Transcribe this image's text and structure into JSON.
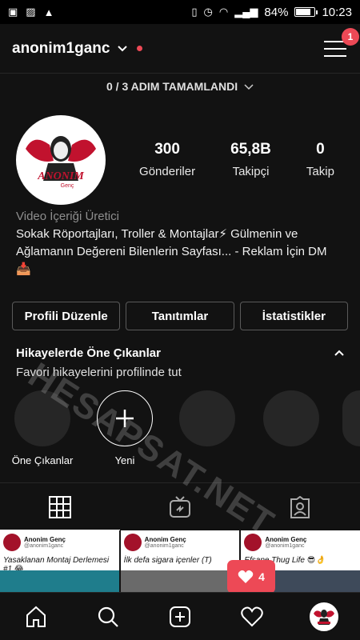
{
  "status_bar": {
    "battery": "84%",
    "battery_level": 0.84,
    "time": "10:23"
  },
  "header": {
    "username": "anonim1ganc",
    "notification_count": "1"
  },
  "steps_text": "0 / 3 ADIM TAMAMLANDI",
  "profile": {
    "avatar_text": "ANONIM",
    "avatar_subtext": "Genç",
    "stats": [
      {
        "value": "300",
        "label": "Gönderiler"
      },
      {
        "value": "65,8B",
        "label": "Takipçi"
      },
      {
        "value": "0",
        "label": "Takip"
      }
    ],
    "category": "Video İçeriği Üretici",
    "bio_line1": "Sokak Röportajları, Troller & Montajlar⚡ Gülmenin ve",
    "bio_line2": "Ağlamanın Değereni Bilenlerin Sayfası... - Reklam İçin DM",
    "bio_line3": "📥"
  },
  "buttons": {
    "edit_profile": "Profili Düzenle",
    "promotions": "Tanıtımlar",
    "insights": "İstatistikler"
  },
  "highlights": {
    "title": "Hikayelerde Öne Çıkanlar",
    "subtitle": "Favori hikayelerini profilinde tut",
    "first_label": "Öne Çıkanlar",
    "new_label": "Yeni"
  },
  "posts": [
    {
      "name": "Anonim Genç",
      "handle": "@anonim1ganc",
      "title": "Yasaklanan Montaj Derlemesi #1 😂"
    },
    {
      "name": "Anonim Genç",
      "handle": "@anonim1ganc",
      "title": "İlk defa sigara içenler (T)"
    },
    {
      "name": "Anonim Genç",
      "handle": "@anonim1ganc",
      "title": "Efsane Thug Life 😎👌"
    }
  ],
  "likes_popup": {
    "count": "4"
  },
  "watermark": "HESAPSAT.NET",
  "colors": {
    "background": "#121212",
    "accent_red": "#ed4956"
  }
}
